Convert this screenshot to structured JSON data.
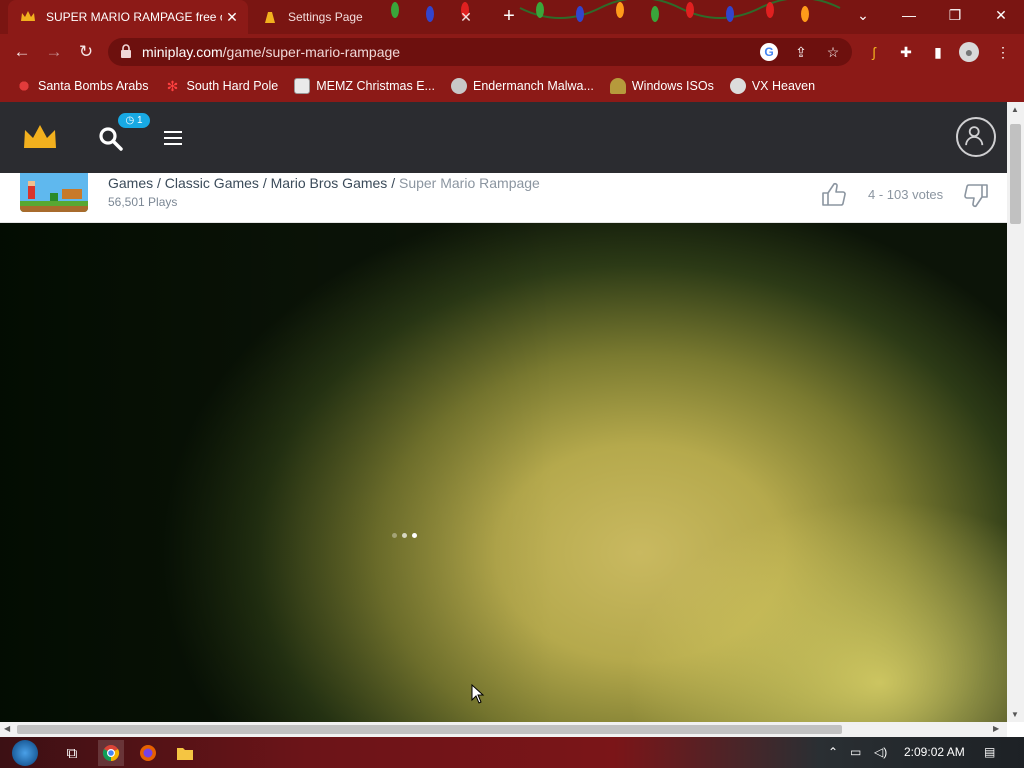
{
  "browser": {
    "tabs": [
      {
        "title": "SUPER MARIO RAMPAGE free on",
        "active": true
      },
      {
        "title": "Settings Page",
        "active": false
      }
    ],
    "url_domain": "miniplay.com",
    "url_path": "/game/super-mario-rampage",
    "bookmarks": [
      {
        "label": "Santa Bombs Arabs",
        "icon": "santa-icon"
      },
      {
        "label": "South Hard Pole",
        "icon": "snowflake-icon"
      },
      {
        "label": "MEMZ Christmas E...",
        "icon": "memz-icon"
      },
      {
        "label": "Endermanch Malwa...",
        "icon": "raccoon-icon"
      },
      {
        "label": "Windows ISOs",
        "icon": "figure-icon"
      },
      {
        "label": "VX Heaven",
        "icon": "vx-icon"
      }
    ]
  },
  "site": {
    "badge_count": "1",
    "breadcrumb": {
      "games": "Games",
      "sep": " / ",
      "classic": "Classic Games",
      "mario": "Mario Bros Games",
      "current": "Super Mario Rampage"
    },
    "plays": "56,501 Plays",
    "votes": "4 - 103 votes"
  },
  "taskbar": {
    "time": "2:09:02 AM"
  },
  "colors": {
    "browser_frame": "#8c1a17",
    "site_header": "#2b2c30",
    "badge": "#18a9e3",
    "crown": "#f2b01e"
  }
}
